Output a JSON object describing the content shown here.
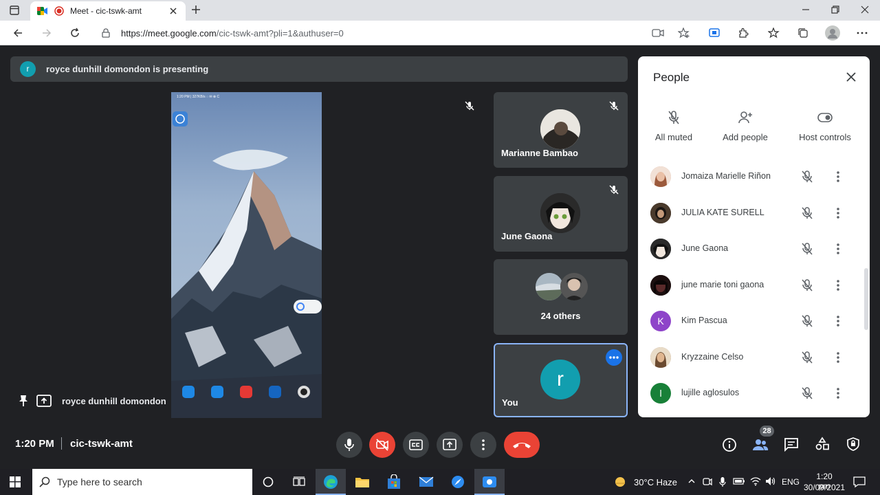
{
  "browser": {
    "tab_title": "Meet - cic-tswk-amt",
    "url_host": "https://meet.google.com",
    "url_path": "/cic-tswk-amt?pli=1&authuser=0"
  },
  "meet": {
    "banner_initial": "r",
    "banner_text": "royce dunhill domondon is presenting",
    "presenter_name": "royce dunhill domondon",
    "tiles": [
      {
        "name": "Marianne Bambao"
      },
      {
        "name": "June Gaona"
      },
      {
        "name": "24 others"
      },
      {
        "name": "You",
        "initial": "r"
      }
    ],
    "time": "1:20 PM",
    "meeting_code": "cic-tswk-amt",
    "people_count": "28"
  },
  "people_panel": {
    "title": "People",
    "actions": [
      {
        "label": "All muted"
      },
      {
        "label": "Add people"
      },
      {
        "label": "Host controls"
      }
    ],
    "participants": [
      {
        "name": "Jomaiza Marielle Riñon",
        "initial": "",
        "color": "#c98f7a"
      },
      {
        "name": "JULIA KATE SURELL",
        "initial": "",
        "color": "#3a3028"
      },
      {
        "name": "June Gaona",
        "initial": "",
        "color": "#222"
      },
      {
        "name": "june marie toni gaona",
        "initial": "",
        "color": "#2b1a1a"
      },
      {
        "name": "Kim Pascua",
        "initial": "K",
        "color": "#8e44c9"
      },
      {
        "name": "Kryzzaine Celso",
        "initial": "",
        "color": "#a07a5a"
      },
      {
        "name": "lujille aglosulos",
        "initial": "l",
        "color": "#188038"
      }
    ]
  },
  "taskbar": {
    "search_placeholder": "Type here to search",
    "weather": "30°C  Haze",
    "language": "ENG",
    "time": "1:20 pm",
    "date": "30/09/2021"
  },
  "colors": {
    "meet_bg": "#202124",
    "tile_bg": "#3c4043",
    "end_call": "#ea4335",
    "accent": "#8ab4f8",
    "teal": "#129eaf"
  }
}
